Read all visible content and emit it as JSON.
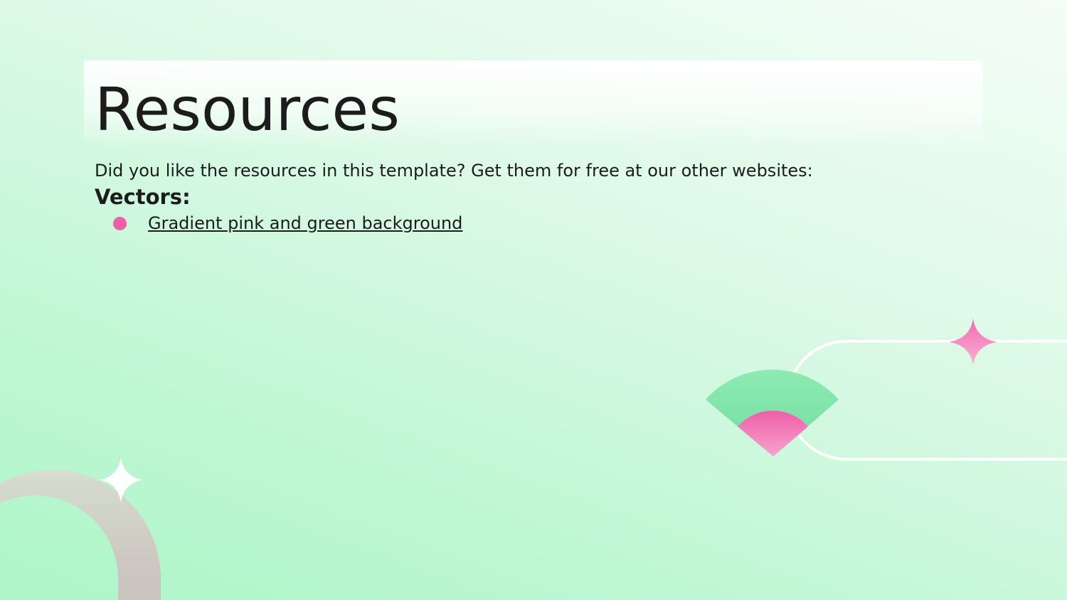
{
  "slide": {
    "title": "Resources",
    "intro": "Did you like the resources in this template? Get them for free at our other websites:",
    "section_heading": "Vectors:",
    "links": [
      {
        "label": "Gradient pink and green background"
      }
    ]
  },
  "colors": {
    "background_light": "#f4fdf7",
    "background_green": "#aef5c8",
    "accent_pink": "#ee5fa8",
    "accent_green": "#7fe3a8",
    "ring_gray": "#cfc7c1",
    "text": "#1c1c1c"
  },
  "decorations": {
    "sparkle_white": "four-point-star",
    "sparkle_pink": "four-point-star",
    "ring": "half-ring",
    "fan": "quarter-circle-fan",
    "pill_outline": "rounded-capsule-outline"
  }
}
